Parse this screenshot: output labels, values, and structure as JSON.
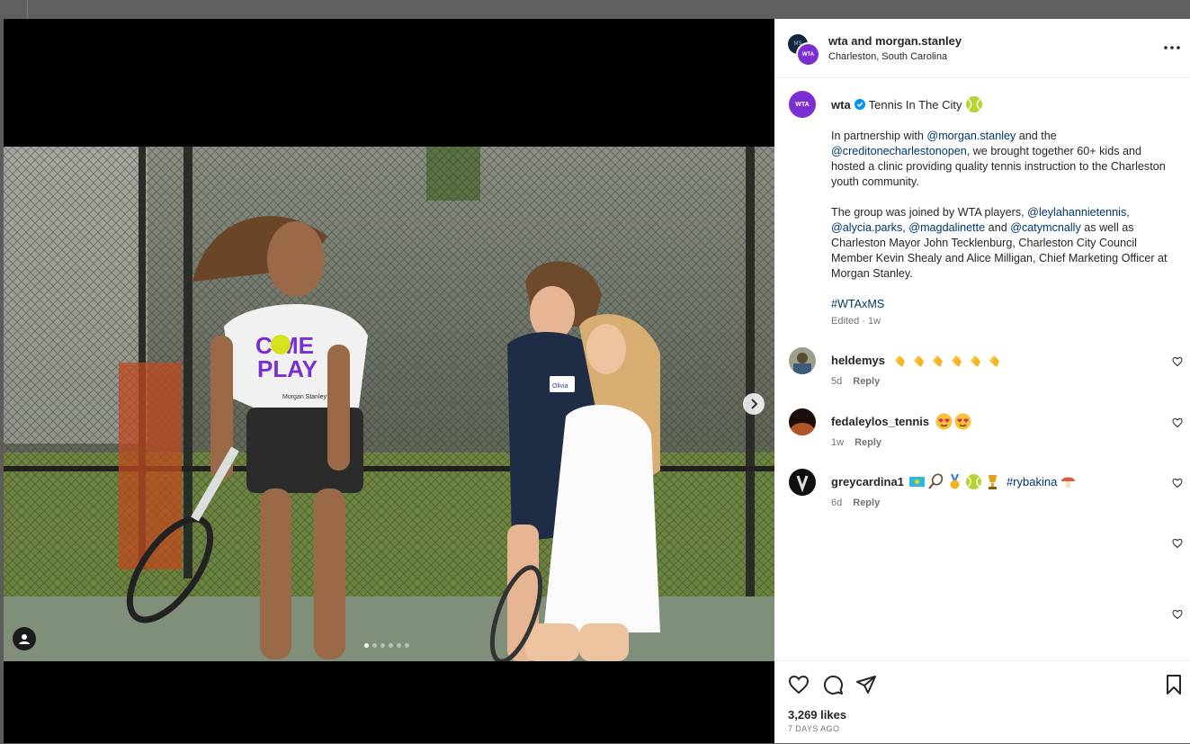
{
  "post": {
    "header": {
      "accounts": "wta and morgan.stanley",
      "location": "Charleston, South Carolina",
      "avatar_label": "WTA"
    },
    "caption": {
      "username": "wta",
      "title": "Tennis In The City",
      "p1_a": "In partnership with ",
      "p1_link1": "@morgan.stanley",
      "p1_b": " and the ",
      "p1_link2": "@creditonecharlestonopen",
      "p1_c": ", we brought together 60+ kids and hosted a clinic providing quality tennis instruction to the Charleston youth community.",
      "p2_a": "The group was joined by WTA players, ",
      "p2_link1": "@leylahannietennis",
      "p2_sep1": ", ",
      "p2_link2": "@alycia.parks",
      "p2_sep2": ", ",
      "p2_link3": "@magdalinette",
      "p2_sep3": " and ",
      "p2_link4": "@catymcnally",
      "p2_b": " as well as Charleston Mayor John Tecklenburg, Charleston City Council Member Kevin Shealy and Alice Milligan, Chief Marketing Officer at Morgan Stanley.",
      "hashtag": "#WTAxMS",
      "edited": "Edited · 1w"
    },
    "comments": [
      {
        "username": "heldemys",
        "emoji": "clapping-hands x6",
        "age": "5d",
        "reply": "Reply"
      },
      {
        "username": "fedaleylos_tennis",
        "emoji": "heart-eyes x2",
        "age": "1w",
        "reply": "Reply"
      },
      {
        "username": "greycardina1",
        "emoji": "flag, racket, medal, ball, trophy",
        "hashtag": "#rybakina",
        "age": "6d",
        "reply": "Reply"
      }
    ],
    "likes": "3,269 likes",
    "posted": "7 DAYS AGO"
  },
  "media": {
    "shirt_line1": "C ME",
    "shirt_line2": "PLAY",
    "shirt_sponsor": "Morgan Stanley",
    "badge": "Olivia",
    "carousel_index": 1,
    "carousel_count": 6
  },
  "colors": {
    "link": "#00376b",
    "wta_purple": "#7b2fd0",
    "verified": "#0095f6",
    "muted": "#737373"
  }
}
